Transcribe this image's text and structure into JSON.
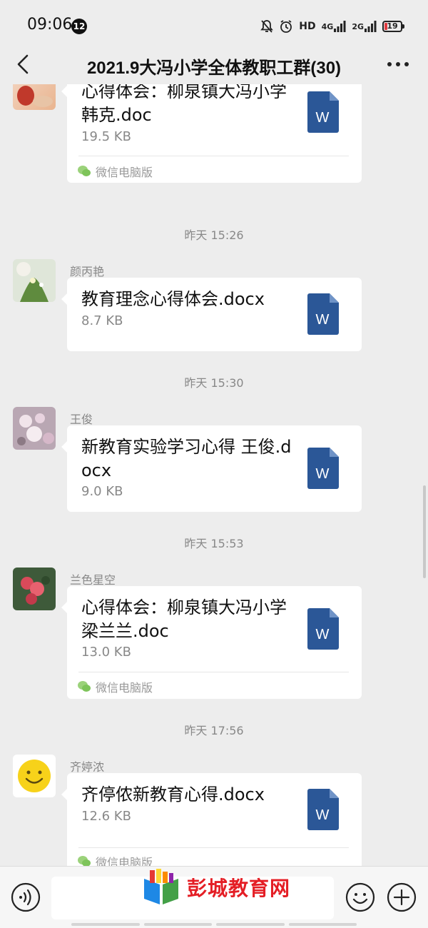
{
  "status_bar": {
    "time": "09:06",
    "notification_count": "12",
    "network_hd": "HD",
    "network_1": "4G",
    "network_2": "2G",
    "battery": "19"
  },
  "header": {
    "title": "2021.9大冯小学全体教职工群(30)",
    "back_icon": "chevron-left-icon",
    "more_icon": "more-dots-icon"
  },
  "messages": [
    {
      "sender": "",
      "file_name": "心得体会：柳泉镇大冯小学韩克.doc",
      "file_size": "19.5 KB",
      "source": "微信电脑版",
      "avatar": "photo-avatar-red"
    },
    {
      "timestamp": "昨天 15:26",
      "sender": "颜丙艳",
      "file_name": "教育理念心得体会.docx",
      "file_size": "8.7 KB",
      "source": "",
      "avatar": "photo-avatar-plant"
    },
    {
      "timestamp": "昨天 15:30",
      "sender": "王俊",
      "file_name": "新教育实验学习心得 王俊.docx",
      "file_size": "9.0 KB",
      "source": "",
      "avatar": "photo-avatar-flowers"
    },
    {
      "timestamp": "昨天 15:53",
      "sender": "兰色星空",
      "file_name": "心得体会：柳泉镇大冯小学 梁兰兰.doc",
      "file_size": "13.0 KB",
      "source": "微信电脑版",
      "avatar": "photo-avatar-blossom"
    },
    {
      "timestamp": "昨天 17:56",
      "sender": "齐婷浓",
      "file_name": "齐停侬新教育心得.docx",
      "file_size": "12.6 KB",
      "source": "微信电脑版",
      "avatar": "smiley-avatar"
    }
  ],
  "file_icon_letter": "W",
  "input_bar": {
    "voice_icon": "voice-icon",
    "emoji_icon": "emoji-icon",
    "plus_icon": "plus-icon"
  },
  "watermark": {
    "text": "彭城教育网"
  },
  "colors": {
    "background": "#ededed",
    "bubble": "#ffffff",
    "word_blue": "#2b5797",
    "watermark_red": "#e41e25"
  }
}
